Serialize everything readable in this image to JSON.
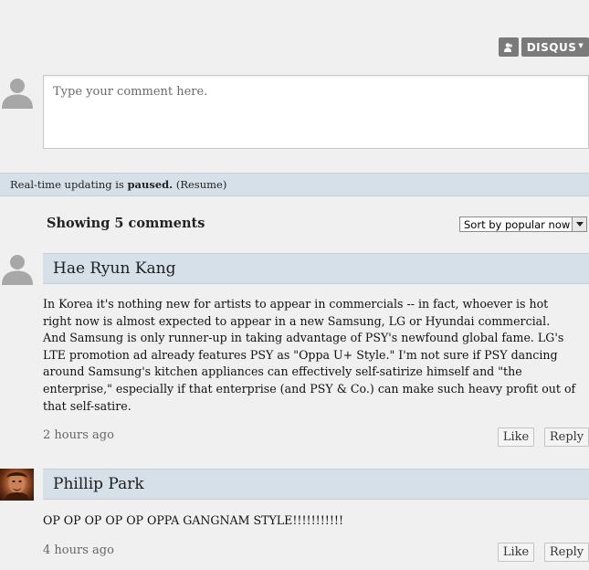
{
  "header": {
    "brand_label": "DISQUS",
    "user_icon": "user-icon",
    "caret_icon": "caret-down-icon"
  },
  "composer": {
    "placeholder": "Type your comment here.",
    "avatar_icon": "default-avatar-icon"
  },
  "realtime": {
    "prefix": "Real-time updating is",
    "status": "paused.",
    "resume_label": "(Resume)"
  },
  "comments_header": {
    "showing_label": "Showing 5 comments",
    "sort_value": "Sort by popular now",
    "sort_arrow_icon": "dropdown-arrow-icon"
  },
  "comments": [
    {
      "author": "Hae Ryun Kang",
      "avatar": "default-avatar-icon",
      "body_lines": [
        "In Korea it's nothing new for artists to appear in commercials -- in fact, whoever is hot",
        "right now is almost expected to appear in a new Samsung, LG or Hyundai commercial.",
        "And Samsung is only runner-up in taking advantage of PSY's newfound global fame. LG's",
        "LTE promotion ad already features PSY as \"Oppa U+ Style.\" I'm not sure if PSY dancing",
        "around Samsung's kitchen appliances can effectively self-satirize himself and \"the",
        "enterprise,\" especially if that enterprise (and PSY & Co.) can make such heavy profit out of",
        "that self-satire."
      ],
      "time": "2 hours ago",
      "like_label": "Like",
      "reply_label": "Reply"
    },
    {
      "author": "Phillip Park",
      "avatar": "user-photo-avatar",
      "body_lines": [
        "OP OP OP OP OP OPPA GANGNAM STYLE!!!!!!!!!!!"
      ],
      "time": "4 hours ago",
      "like_label": "Like",
      "reply_label": "Reply"
    }
  ],
  "colors": {
    "page_bg": "#f0f0f0",
    "bar_bg": "#d6e0e8",
    "brand_bg": "#7a7a7a"
  }
}
